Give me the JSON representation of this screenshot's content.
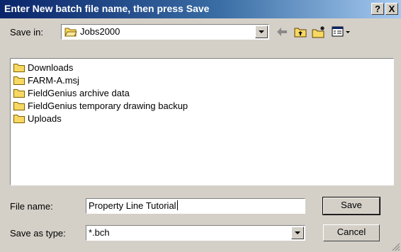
{
  "dialog": {
    "title": "Enter New batch file name, then press Save",
    "help_button": "?",
    "close_button": "X"
  },
  "save_in": {
    "label": "Save in:",
    "value": "Jobs2000"
  },
  "file_list": {
    "items": [
      {
        "name": "Downloads",
        "icon": "folder-icon"
      },
      {
        "name": "FARM-A.msj",
        "icon": "folder-icon"
      },
      {
        "name": "FieldGenius archive data",
        "icon": "folder-icon"
      },
      {
        "name": "FieldGenius temporary drawing backup",
        "icon": "folder-icon"
      },
      {
        "name": "Uploads",
        "icon": "folder-icon"
      }
    ]
  },
  "file_name": {
    "label": "File name:",
    "value": "Property Line Tutorial"
  },
  "save_as_type": {
    "label": "Save as type:",
    "value": "*.bch"
  },
  "buttons": {
    "save": "Save",
    "cancel": "Cancel"
  },
  "colors": {
    "title_start": "#0a246a",
    "title_end": "#a6caf0",
    "face": "#d4d0c8",
    "folder": "#f7d862"
  }
}
